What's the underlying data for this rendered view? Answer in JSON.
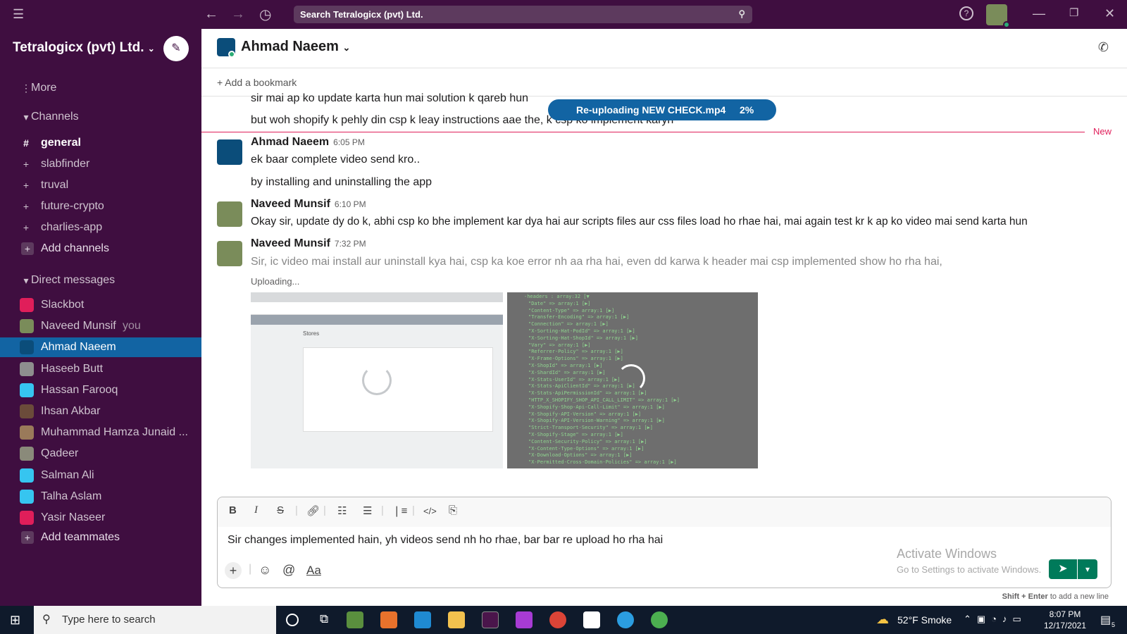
{
  "topbar": {
    "search_placeholder": "Search Tetralogicx (pvt) Ltd."
  },
  "workspace": {
    "name": "Tetralogicx (pvt) Ltd."
  },
  "sidebar": {
    "more": "More",
    "channels_header": "Channels",
    "channels": [
      {
        "name": "general",
        "active": true
      },
      {
        "name": "slabfinder"
      },
      {
        "name": "truval"
      },
      {
        "name": "future-crypto"
      },
      {
        "name": "charlies-app"
      }
    ],
    "add_channels": "Add channels",
    "dm_header": "Direct messages",
    "dms": [
      {
        "name": "Slackbot",
        "color": "#e01e5a"
      },
      {
        "name": "Naveed Munsif",
        "suffix": "you",
        "color": "#7a8c5a"
      },
      {
        "name": "Ahmad Naeem",
        "color": "#0b4d7a",
        "active": true
      },
      {
        "name": "Haseeb Butt",
        "color": "#8e8e8e"
      },
      {
        "name": "Hassan Farooq",
        "color": "#36c5f0"
      },
      {
        "name": "Ihsan Akbar",
        "color": "#6b4b3a"
      },
      {
        "name": "Muhammad Hamza Junaid ...",
        "color": "#9a7a5a"
      },
      {
        "name": "Qadeer",
        "color": "#8a8a7a"
      },
      {
        "name": "Salman Ali",
        "color": "#36c5f0"
      },
      {
        "name": "Talha Aslam",
        "color": "#36c5f0"
      },
      {
        "name": "Yasir Naseer",
        "color": "#e01e5a"
      }
    ],
    "add_teammates": "Add teammates"
  },
  "channel": {
    "name": "Ahmad Naeem",
    "bookmark": "Add a bookmark"
  },
  "upload": {
    "label": "Re-uploading NEW CHECK.mp4",
    "progress": "2%",
    "new_label": "New"
  },
  "messages": {
    "prev1": "sir mai ap ko update karta hun mai solution k qareb hun",
    "prev2": "but woh shopify k pehly din csp k leay instructions aae the, k csp ko implement karyn",
    "m1_author": "Ahmad Naeem",
    "m1_time": "6:05 PM",
    "m1_text": "ek baar complete video send kro..",
    "m1_text2": "by installing and uninstalling the app",
    "m2_author": "Naveed Munsif",
    "m2_time": "6:10 PM",
    "m2_text": "Okay sir, update dy do k, abhi csp ko bhe implement kar dya hai aur scripts files aur css files load ho rhae hai, mai again test kr k ap ko video mai send karta hun",
    "m3_author": "Naveed Munsif",
    "m3_time": "7:32 PM",
    "m3_text": "Sir, ic video mai install aur uninstall kya hai, csp ka koe error nh aa rha hai, even dd karwa k header mai csp implemented show ho rha hai,",
    "uploading": "Uploading...",
    "att1_title": "Stores",
    "att2_lines": [
      "-headers : array:32 [▼",
      "\"Date\" => array:1 [▶]",
      "\"Content-Type\" => array:1 [▶]",
      "\"Transfer-Encoding\" => array:1 [▶]",
      "\"Connection\" => array:1 [▶]",
      "\"X-Sorting-Hat-PodId\" => array:1 [▶]",
      "\"X-Sorting-Hat-ShopId\" => array:1 [▶]",
      "\"Vary\" => array:1 [▶]",
      "\"Referrer-Policy\" => array:1 [▶]",
      "\"X-Frame-Options\" => array:1 [▶]",
      "\"X-ShopId\" => array:1 [▶]",
      "\"X-ShardId\" => array:1 [▶]",
      "\"X-Stats-UserId\" => array:1 [▶]",
      "\"X-Stats-ApiClientId\" => array:1 [▶]",
      "\"X-Stats-ApiPermissionId\" => array:1 [▶]",
      "\"HTTP_X_SHOPIFY_SHOP_API_CALL_LIMIT\" => array:1 [▶]",
      "\"X-Shopify-Shop-Api-Call-Limit\" => array:1 [▶]",
      "\"X-Shopify-API-Version\" => array:1 [▶]",
      "\"X-Shopify-API-Version-Warning\" => array:1 [▶]",
      "\"Strict-Transport-Security\" => array:1 [▶]",
      "\"X-Shopify-Stage\" => array:1 [▶]",
      "\"Content-Security-Policy\" => array:1 [▶]",
      "\"X-Content-Type-Options\" => array:1 [▶]",
      "\"X-Download-Options\" => array:1 [▶]",
      "\"X-Permitted-Cross-Domain-Policies\" => array:1 [▶]"
    ]
  },
  "composer": {
    "text": "Sir changes implemented hain, yh videos send nh ho rhae, bar bar re upload ho rha hai",
    "hint_key": "Shift + Enter",
    "hint_rest": "to add a new line",
    "format_label": "Aa",
    "activate_title": "Activate Windows",
    "activate_sub": "Go to Settings to activate Windows."
  },
  "taskbar": {
    "search": "Type here to search",
    "weather": "52°F  Smoke",
    "time": "8:07 PM",
    "date": "12/17/2021",
    "notifications": "5"
  }
}
